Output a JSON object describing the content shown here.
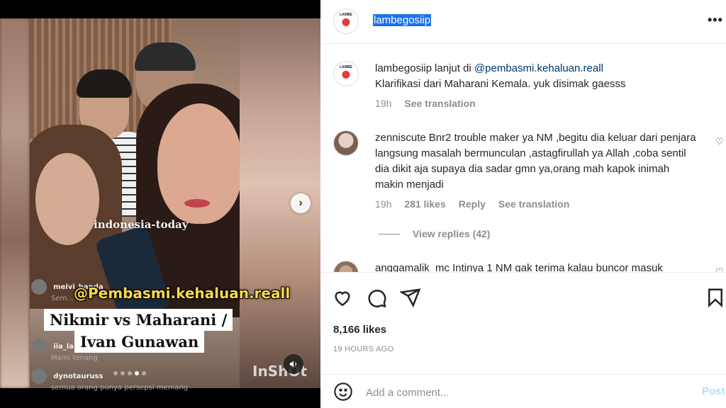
{
  "media": {
    "watermark": "indonesia-today",
    "overlay_handle": "@Pembasmi.kehaluan.reall",
    "title_line1": "Nikmir vs Maharani /",
    "title_line2": "Ivan Gunawan",
    "live_comments": [
      {
        "name": "meivi_banda",
        "text": "Sem..."
      },
      {
        "name": "iia_la...",
        "text": "Mami tenang"
      },
      {
        "name": "dynotauruss",
        "text": "semua orang punya persepsi memang"
      }
    ],
    "editor_watermark": "InShOt",
    "carousel_dots": 5,
    "carousel_active": 3
  },
  "header": {
    "username": "lambegosiip",
    "more_icon": "more-horizontal-icon"
  },
  "caption": {
    "username": "lambegosiip",
    "text_pre": "lanjut di ",
    "mention": "@pembasmi.kehaluan.reall",
    "text_line2": "Klarifikasi dari Maharani Kemala. yuk disimak gaesss",
    "time": "19h",
    "see_translation": "See translation"
  },
  "comments": [
    {
      "username": "zenniscute",
      "text": "Bnr2 trouble maker ya NM ,begitu dia keluar dari penjara langsung masalah bermunculan ,astagfirullah ya Allah ,coba sentil dia dikit aja supaya dia sadar gmn ya,orang mah kapok inimah makin menjadi",
      "time": "19h",
      "likes": "281 likes",
      "reply": "Reply",
      "see_translation": "See translation",
      "view_replies": "View replies (42)"
    },
    {
      "username": "anggamalik_mc",
      "text": "Intinya 1 NM gak terima kalau buncor masuk"
    }
  ],
  "actions": {
    "likes": "8,166 likes",
    "time_ago": "19 HOURS AGO"
  },
  "add_comment": {
    "placeholder": "Add a comment...",
    "post_label": "Post"
  }
}
